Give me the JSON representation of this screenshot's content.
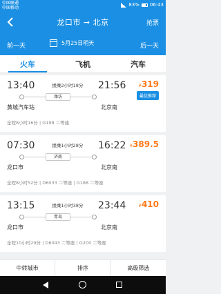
{
  "status": {
    "carrier1": "中国联通",
    "carrier2": "中国移动",
    "battery": "83%",
    "time": "06:43"
  },
  "header": {
    "title": "龙口市 ➞ 北京",
    "right_button": "抢票"
  },
  "datebar": {
    "prev": "前一天",
    "date": "5月25日明天",
    "next": "后一天"
  },
  "tabs": [
    "火车",
    "飞机",
    "汽车"
  ],
  "trips": [
    {
      "dep_time": "13:40",
      "arr_time": "21:56",
      "transfer": "换乘2小时18分",
      "via": "潍坊",
      "dep_station": "黄城汽车站",
      "arr_station": "北京南",
      "price_symbol": "¥",
      "price": "319",
      "badge": "最优推荐",
      "info": "全程8小时16分 | G198 二等座"
    },
    {
      "dep_time": "07:30",
      "arr_time": "16:22",
      "transfer": "换乘1小时28分",
      "via": "济南",
      "dep_station": "龙口市",
      "arr_station": "北京南",
      "price_symbol": "¥",
      "price": "389.5",
      "badge": "",
      "info": "全程8小时52分 | D6033 二等座 | G188 二等座"
    },
    {
      "dep_time": "13:15",
      "arr_time": "23:44",
      "transfer": "换乘1小时38分",
      "via": "青岛",
      "dep_station": "龙口市",
      "arr_station": "北京南",
      "price_symbol": "¥",
      "price": "410",
      "badge": "",
      "info": "全程10小时29分 | D6043 二等座 | G200 二等座"
    }
  ],
  "bottom": [
    "中转城市",
    "排序",
    "高级筛选"
  ],
  "colors": {
    "primary": "#1a8fe3",
    "price": "#ff7a1a"
  }
}
